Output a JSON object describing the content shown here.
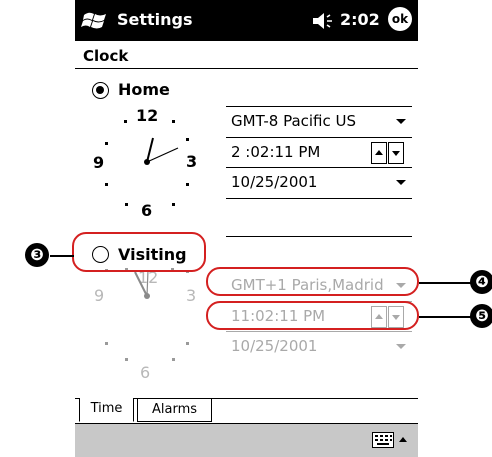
{
  "titlebar": {
    "title": "Settings",
    "time": "2:02",
    "ok_label": "ok",
    "start_icon": "windows-flag-icon",
    "volume_icon": "speaker-icon"
  },
  "page": {
    "title": "Clock"
  },
  "home": {
    "label": "Home",
    "selected": true,
    "timezone": "GMT-8 Pacific US",
    "time": "2 :02:11 PM",
    "date": "10/25/2001",
    "clock_numbers": [
      "12",
      "3",
      "6",
      "9"
    ]
  },
  "visiting": {
    "label": "Visiting",
    "selected": false,
    "timezone": "GMT+1 Paris,Madrid",
    "time": "11:02:11 PM",
    "date": "10/25/2001",
    "clock_numbers": [
      "12",
      "3",
      "6",
      "9"
    ]
  },
  "callouts": {
    "c3": "❸",
    "c4": "❹",
    "c5": "❺",
    "color": "#d42020"
  },
  "tabs": [
    {
      "label": "Time",
      "active": true
    },
    {
      "label": "Alarms",
      "active": false
    }
  ],
  "menubar": {
    "keyboard_icon": "keyboard-icon"
  }
}
